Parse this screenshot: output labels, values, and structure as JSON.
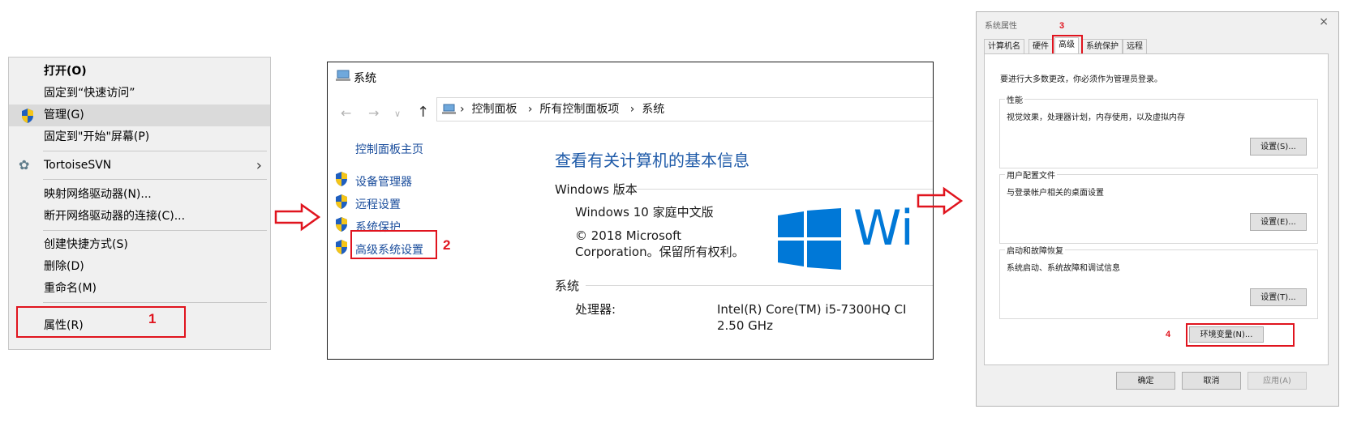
{
  "context_menu": {
    "items": [
      {
        "label": "打开(O)"
      },
      {
        "label": "固定到“快速访问”"
      },
      {
        "label": "管理(G)"
      },
      {
        "label": "固定到\"开始\"屏幕(P)"
      },
      {
        "label": "TortoiseSVN"
      },
      {
        "label": "映射网络驱动器(N)..."
      },
      {
        "label": "断开网络驱动器的连接(C)..."
      },
      {
        "label": "创建快捷方式(S)"
      },
      {
        "label": "删除(D)"
      },
      {
        "label": "重命名(M)"
      },
      {
        "label": "属性(R)"
      }
    ],
    "step_number": "1"
  },
  "system_window": {
    "title": "系统",
    "breadcrumb": [
      "控制面板",
      "所有控制面板项",
      "系统"
    ],
    "left_home": "控制面板主页",
    "left_links": [
      "设备管理器",
      "远程设置",
      "系统保护",
      "高级系统设置"
    ],
    "step_number": "2",
    "heading": "查看有关计算机的基本信息",
    "windows_section": "Windows 版本",
    "edition": "Windows 10 家庭中文版",
    "copyright_1": "© 2018 Microsoft",
    "copyright_2": "Corporation。保留所有权利。",
    "logo_text": "Wi",
    "system_section": "系统",
    "processor_label": "处理器:",
    "processor_value_1": "Intel(R) Core(TM) i5-7300HQ CI",
    "processor_value_2": "2.50 GHz"
  },
  "dialog": {
    "title": "系统属性",
    "close": "×",
    "tabs": [
      "计算机名",
      "硬件",
      "高级",
      "系统保护",
      "远程"
    ],
    "active_tab": "高级",
    "step_3": "3",
    "note": "要进行大多数更改，你必须作为管理员登录。",
    "groups": [
      {
        "label": "性能",
        "desc": "视觉效果，处理器计划，内存使用，以及虚拟内存",
        "button": "设置(S)..."
      },
      {
        "label": "用户配置文件",
        "desc": "与登录帐户相关的桌面设置",
        "button": "设置(E)..."
      },
      {
        "label": "启动和故障恢复",
        "desc": "系统启动、系统故障和调试信息",
        "button": "设置(T)..."
      }
    ],
    "env_button": "环境变量(N)...",
    "step_4": "4",
    "ok": "确定",
    "cancel": "取消",
    "apply": "应用(A)"
  },
  "colors": {
    "annotation_red": "#e0141e",
    "link_blue": "#1a4d9c",
    "heading_blue": "#1e5aa8",
    "windows_blue": "#0078d7"
  }
}
